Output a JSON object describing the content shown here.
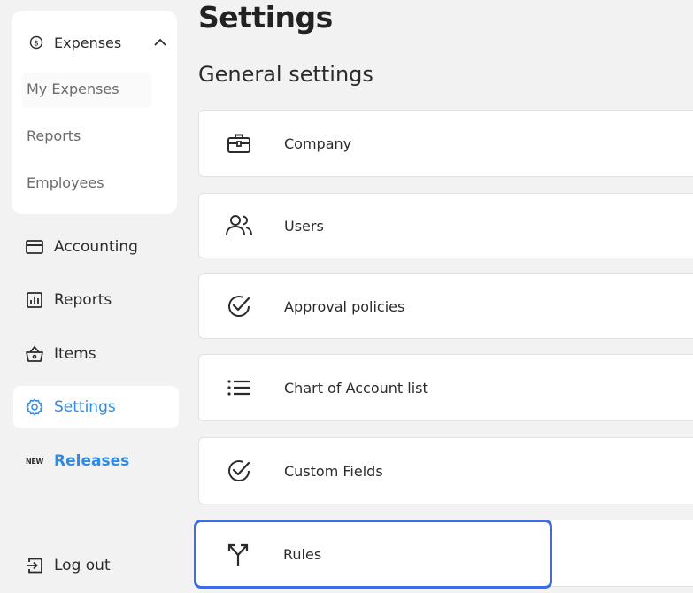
{
  "sidebar": {
    "expenses": {
      "label": "Expenses",
      "sub_items": [
        "My Expenses",
        "Reports",
        "Employees"
      ]
    },
    "nav": [
      {
        "label": "Accounting",
        "icon": "credit-card-icon"
      },
      {
        "label": "Reports",
        "icon": "bar-chart-icon"
      },
      {
        "label": "Items",
        "icon": "basket-icon"
      },
      {
        "label": "Settings",
        "icon": "gear-icon"
      },
      {
        "label": "Releases",
        "icon": "new-badge-icon",
        "badge": "NEW"
      }
    ],
    "logout_label": "Log out"
  },
  "main": {
    "title": "Settings",
    "section_title": "General settings",
    "cards": [
      {
        "label": "Company",
        "icon": "briefcase-icon"
      },
      {
        "label": "Users",
        "icon": "users-icon"
      },
      {
        "label": "Approval policies",
        "icon": "check-circle-icon"
      },
      {
        "label": "Chart of Account list",
        "icon": "list-icon"
      },
      {
        "label": "Custom Fields",
        "icon": "check-circle-icon"
      },
      {
        "label": "Rules",
        "icon": "split-arrows-icon"
      }
    ]
  },
  "colors": {
    "accent": "#2d8ae6",
    "focus_border": "#3b6de8",
    "background": "#f2f2f2"
  }
}
